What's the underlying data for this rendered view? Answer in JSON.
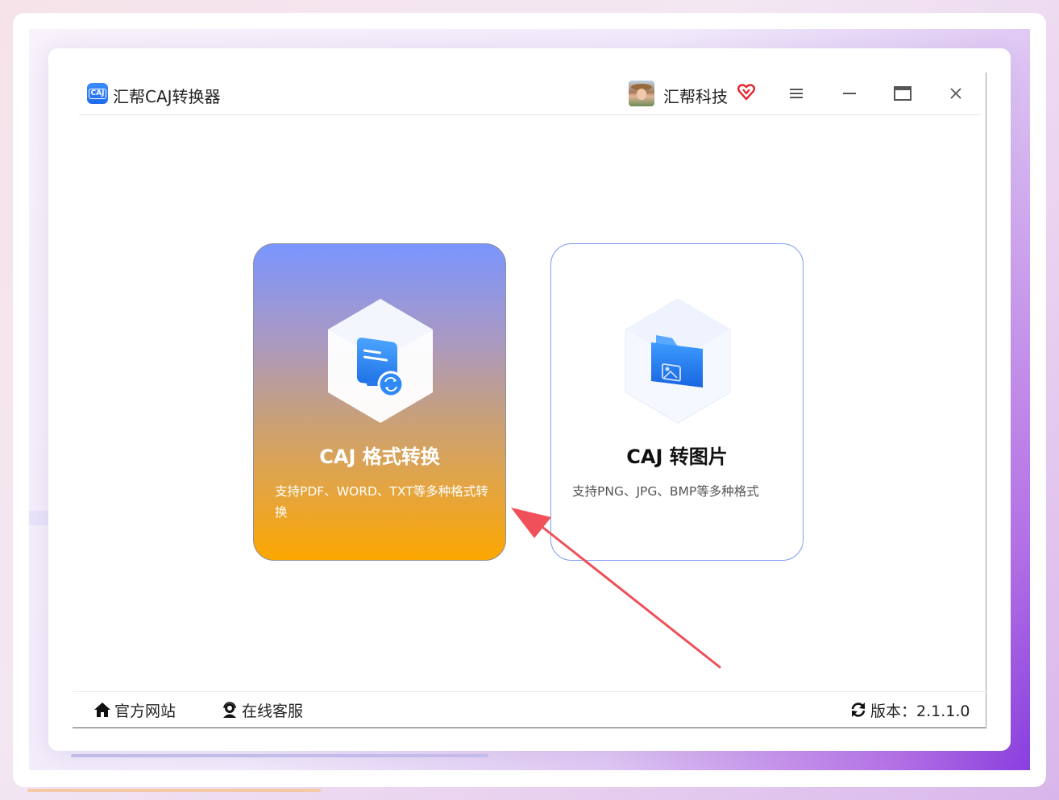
{
  "app": {
    "title": "汇帮CAJ转换器",
    "logo_text": "CAJ",
    "logo_icon": "caj-app-icon"
  },
  "user": {
    "name": "汇帮科技",
    "avatar_icon": "user-avatar",
    "vip_icon": "vip-heart-icon"
  },
  "window_controls": {
    "menu_icon": "hamburger-menu-icon",
    "minimize_icon": "minimize-icon",
    "maximize_icon": "maximize-icon",
    "close_icon": "close-icon"
  },
  "cards": [
    {
      "title": "CAJ 格式转换",
      "description": "支持PDF、WORD、TXT等多种格式转换",
      "icon": "document-convert-icon",
      "accent_top": "#7a95ff",
      "accent_bottom": "#fca600"
    },
    {
      "title": "CAJ 转图片",
      "description": "支持PNG、JPG、BMP等多种格式",
      "icon": "folder-image-icon",
      "border_color": "#7d9cf0"
    }
  ],
  "footer": {
    "website_label": "官方网站",
    "website_icon": "home-icon",
    "service_label": "在线客服",
    "service_icon": "support-agent-icon",
    "version_label": "版本：2.1.1.0",
    "version_icon": "refresh-icon"
  },
  "annotation": {
    "arrow_color": "#f0505a",
    "arrow_icon": "red-pointer-arrow"
  }
}
